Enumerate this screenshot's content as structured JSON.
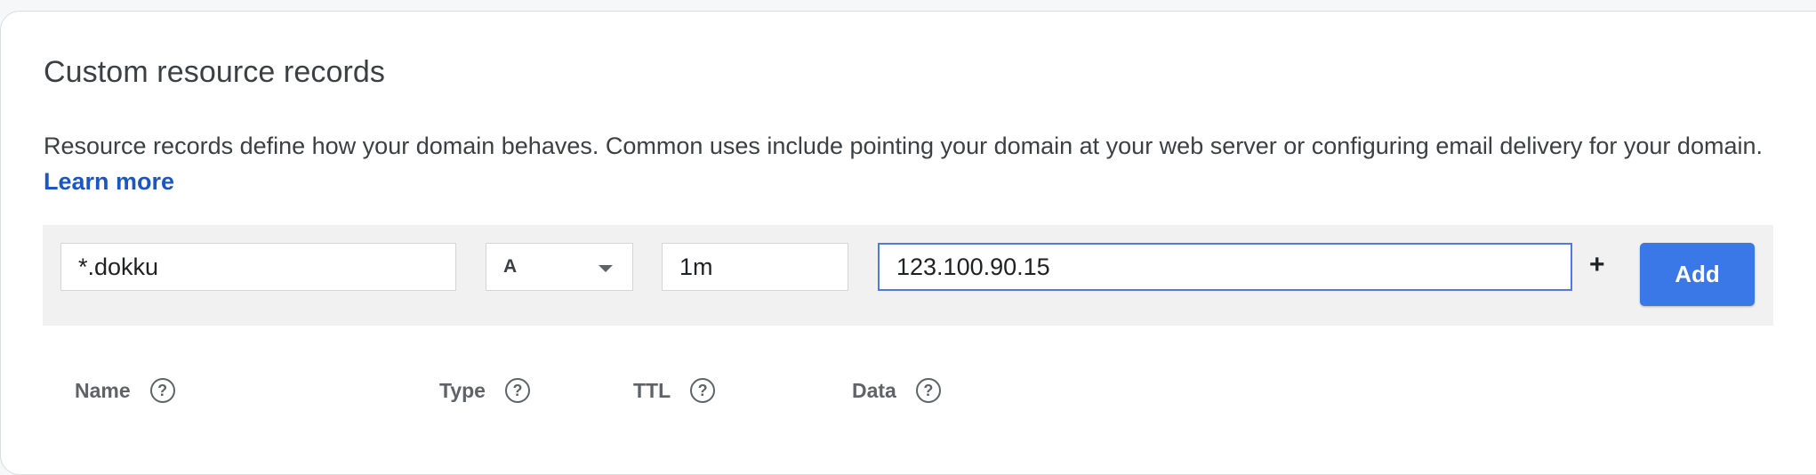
{
  "section": {
    "title": "Custom resource records",
    "description": "Resource records define how your domain behaves. Common uses include pointing your domain at your web server or configuring email delivery for your domain.",
    "learn_more_label": "Learn more"
  },
  "form": {
    "name_value": "*.dokku",
    "type_value": "A",
    "ttl_value": "1m",
    "data_value": "123.100.90.15",
    "plus_label": "+",
    "add_label": "Add"
  },
  "table": {
    "columns": [
      {
        "label": "Name",
        "help_icon": "help-circle-icon"
      },
      {
        "label": "Type",
        "help_icon": "help-circle-icon"
      },
      {
        "label": "TTL",
        "help_icon": "help-circle-icon"
      },
      {
        "label": "Data",
        "help_icon": "help-circle-icon"
      }
    ]
  },
  "colors": {
    "accent": "#3b78e7",
    "link": "#1a57c4",
    "focus_border": "#4a7de0"
  }
}
